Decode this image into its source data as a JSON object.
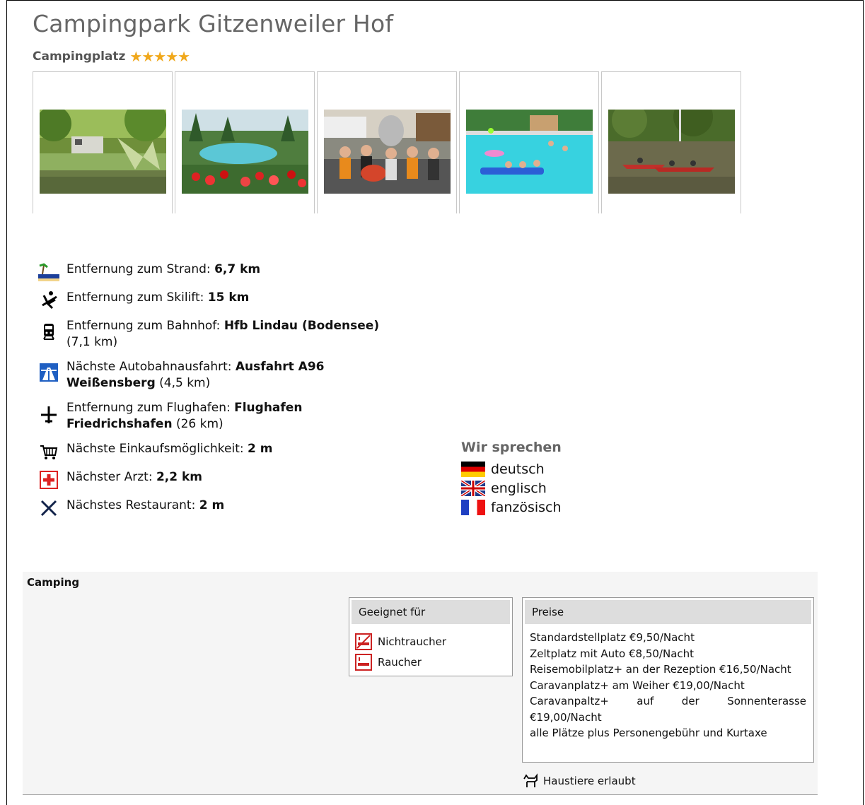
{
  "page": {
    "title": "Campingpark Gitzenweiler Hof",
    "subtitle": "Campingplatz",
    "stars": "★★★★★"
  },
  "gallery": [
    {
      "name": "photo-caravan-lake"
    },
    {
      "name": "photo-pool-flowers"
    },
    {
      "name": "photo-group-mascot"
    },
    {
      "name": "photo-pool-swimmers"
    },
    {
      "name": "photo-canoes"
    }
  ],
  "info": {
    "beach": {
      "label": "Entfernung zum Strand: ",
      "value": "6,7 km"
    },
    "skilift": {
      "label": "Entfernung zum Skilift: ",
      "value": "15 km"
    },
    "train": {
      "label": "Entfernung zum Bahnhof: ",
      "value": "Hfb Lindau (Bodensee)",
      "extra": "(7,1 km)"
    },
    "highway": {
      "label": "Nächste Autobahnausfahrt: ",
      "value1": "Ausfahrt A96",
      "value2": "Weißensberg",
      "extra": " (4,5 km)"
    },
    "airport": {
      "label": "Entfernung zum Flughafen: ",
      "value1": "Flughafen",
      "value2": "Friedrichshafen",
      "extra": " (26 km)"
    },
    "shop": {
      "label": "Nächste Einkaufsmöglichkeit: ",
      "value": "2 m"
    },
    "doctor": {
      "label": "Nächster Arzt: ",
      "value": "2,2 km"
    },
    "restaurant": {
      "label": "Nächstes Restaurant: ",
      "value": "2 m"
    }
  },
  "languages": {
    "heading": "Wir sprechen",
    "items": [
      "deutsch",
      "englisch",
      "fanzösisch"
    ]
  },
  "camping": {
    "label": "Camping",
    "suitable": {
      "heading": "Geeignet für",
      "items": [
        "Nichtraucher",
        "Raucher"
      ]
    },
    "prices": {
      "heading": "Preise",
      "lines": [
        "Standardstellplatz €9,50/Nacht",
        "Zeltplatz mit Auto €8,50/Nacht",
        "Reisemobilplatz+ an der Rezeption €16,50/Nacht",
        "Caravanplatz+ am Weiher €19,00/Nacht",
        "Caravanpaltz+ auf der Sonnenterasse €19,00/Nacht",
        "alle Plätze plus Personengebühr und Kurtaxe"
      ]
    },
    "pets": "Haustiere erlaubt"
  }
}
